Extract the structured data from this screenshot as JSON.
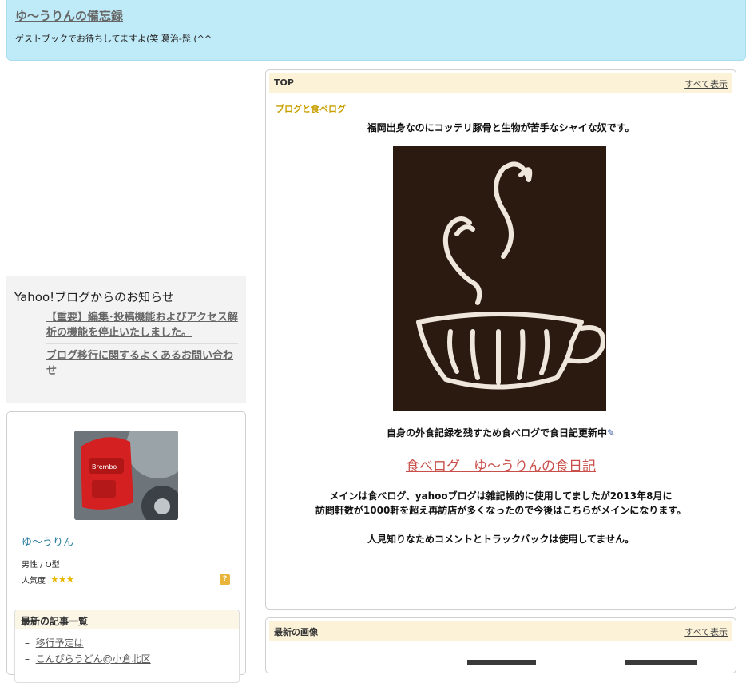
{
  "header": {
    "title": "ゆ〜うりんの備忘録",
    "description": "ゲストブックでお待ちしてますよ(笑 葛治-髭 (^^"
  },
  "notice": {
    "title": "Yahoo!ブログからのお知らせ",
    "links": [
      "【重要】編集･投稿機能およびアクセス解析の機能を停止いたしました。",
      "ブログ移行に関するよくあるお問い合わせ"
    ]
  },
  "profile": {
    "name": "ゆ〜うりん",
    "gender_blood": "男性 / O型",
    "popularity_label": "人気度",
    "popularity_stars": 3,
    "help_icon": "?",
    "recent": {
      "title": "最新の記事一覧",
      "items": [
        "移行予定は",
        "こんぴらうどん@小倉北区"
      ]
    }
  },
  "top_panel": {
    "title": "TOP",
    "show_all": "すべて表示",
    "category": "ブログと食べログ",
    "intro": "福岡出身なのにコッテリ豚骨と生物が苦手なシャイな奴です。",
    "update_text": "自身の外食記録を残すため食べログで食日記更新中",
    "update_icon": "pencil-icon",
    "tabelog_link": "食べログ　ゆ〜うりんの食日記",
    "paragraph_line1": "メインは食べログ、yahooブログは雑記帳的に使用してましたが2013年8月に",
    "paragraph_line2": "訪問軒数が1000軒を超え再訪店が多くなったので今後はこちらがメインになります。",
    "note": "人見知りなためコメントとトラックバックは使用してません。"
  },
  "image_panel": {
    "title": "最新の画像",
    "show_all": "すべて表示"
  },
  "colors": {
    "header_bg": "#bfeaf7",
    "link_red": "#c9504a",
    "category_gold": "#c8a000",
    "panel_head_bg": "#fbf2d8"
  }
}
